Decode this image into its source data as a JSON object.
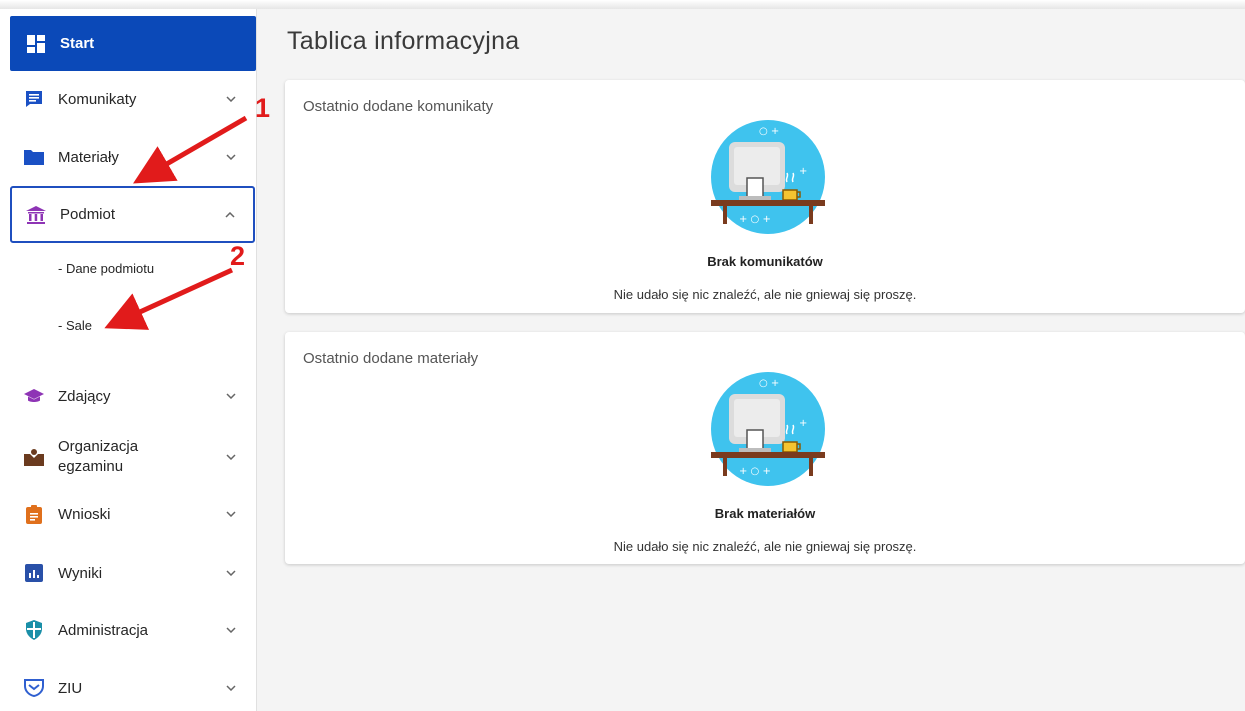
{
  "sidebar": {
    "start": {
      "label": "Start",
      "icon": "dashboard-icon"
    },
    "items": [
      {
        "label": "Komunikaty",
        "icon": "message-icon"
      },
      {
        "label": "Materiały",
        "icon": "folder-icon"
      },
      {
        "label": "Podmiot",
        "icon": "institution-icon"
      },
      {
        "label": "Zdający",
        "icon": "graduation-cap-icon"
      },
      {
        "label": "Organizacja egzaminu",
        "icon": "person-desk-icon"
      },
      {
        "label": "Wnioski",
        "icon": "clipboard-icon"
      },
      {
        "label": "Wyniki",
        "icon": "bar-chart-icon"
      },
      {
        "label": "Administracja",
        "icon": "shield-icon"
      },
      {
        "label": "ZIU",
        "icon": "ziu-logo-icon"
      }
    ],
    "subitems": [
      "- Dane podmiotu",
      "- Sale"
    ]
  },
  "main": {
    "title": "Tablica informacyjna",
    "cards": [
      {
        "heading": "Ostatnio dodane komunikaty",
        "empty_title": "Brak komunikatów",
        "empty_text": "Nie udało się nic znaleźć, ale nie gniewaj się proszę."
      },
      {
        "heading": "Ostatnio dodane materiały",
        "empty_title": "Brak materiałów",
        "empty_text": "Nie udało się nic znaleźć, ale nie gniewaj się proszę."
      }
    ]
  },
  "annotations": [
    "1",
    "2"
  ],
  "colors": {
    "primary": "#0b49b8",
    "annotation": "#e11b1b",
    "illustration": "#3fc3ee"
  }
}
